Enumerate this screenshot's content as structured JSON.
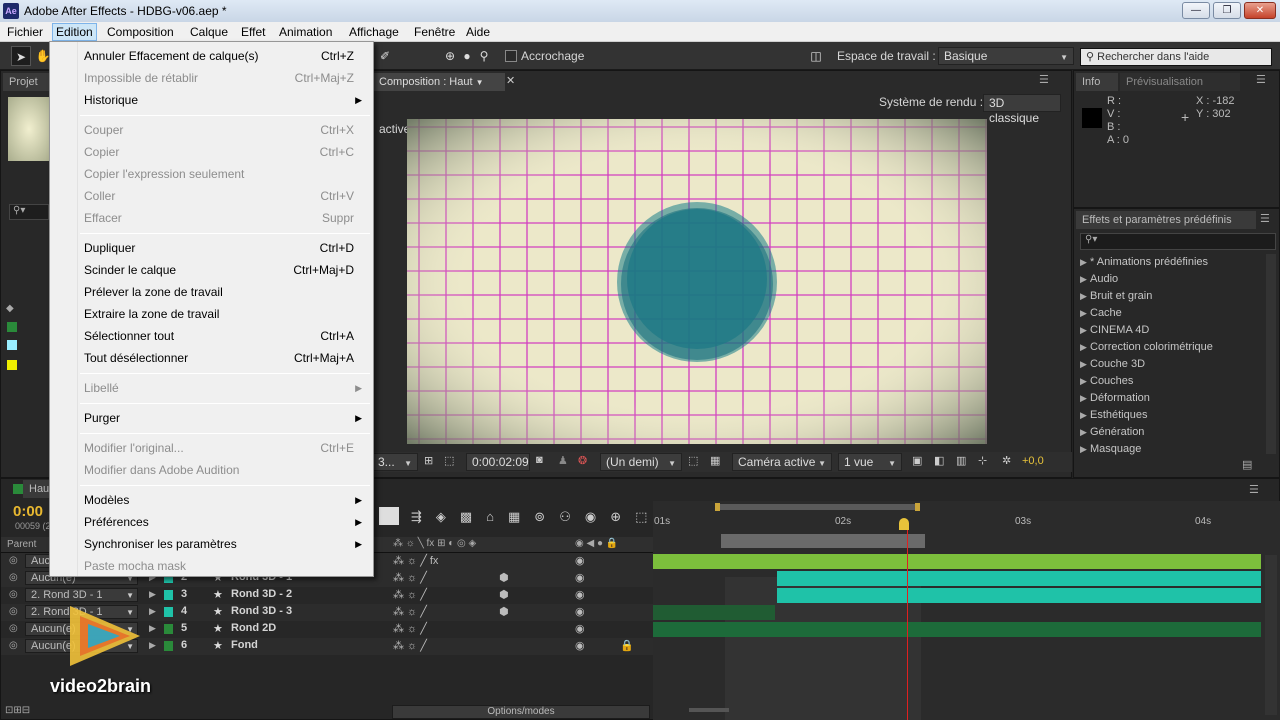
{
  "window": {
    "app_icon": "Ae",
    "title": "Adobe After Effects - HDBG-v06.aep *",
    "minimize": "—",
    "maximize": "❐",
    "close": "✕"
  },
  "menubar": {
    "items": [
      "Fichier",
      "Edition",
      "Composition",
      "Calque",
      "Effet",
      "Animation",
      "Affichage",
      "Fenêtre",
      "Aide"
    ],
    "active": "Edition"
  },
  "toolbar": {
    "snapping_label": "Accrochage",
    "workspace_label": "Espace de travail :",
    "workspace_value": "Basique",
    "help_search_placeholder": "Rechercher dans l'aide"
  },
  "project_panel": {
    "tab": "Projet"
  },
  "composition_panel": {
    "tab": "Composition : Haut",
    "render_label": "Système de rendu :",
    "render_value": "3D classique",
    "active_label": "active",
    "zoom_value": "3...",
    "timecode": "0:00:02:09",
    "resolution_value": "(Un demi)",
    "camera_value": "Caméra active",
    "views_value": "1 vue",
    "exposure_value": "+0,0"
  },
  "info_panel": {
    "tab": "Info",
    "tab2": "Prévisualisation",
    "r": "R :",
    "v": "V :",
    "b": "B :",
    "a": "A : 0",
    "x": "X : -182",
    "y": "Y : 302"
  },
  "effects_panel": {
    "title": "Effets et paramètres prédéfinis",
    "items": [
      "* Animations prédéfinies",
      "Audio",
      "Bruit et grain",
      "Cache",
      "CINEMA 4D",
      "Correction colorimétrique",
      "Couche 3D",
      "Couches",
      "Déformation",
      "Esthétiques",
      "Génération",
      "Masquage"
    ]
  },
  "edit_menu": {
    "items": [
      {
        "label": "Annuler Effacement de calque(s)",
        "shortcut": "Ctrl+Z",
        "enabled": true
      },
      {
        "label": "Impossible de rétablir",
        "shortcut": "Ctrl+Maj+Z",
        "enabled": false
      },
      {
        "label": "Historique",
        "shortcut": "",
        "enabled": true,
        "submenu": true
      },
      {
        "label": "Couper",
        "shortcut": "Ctrl+X",
        "enabled": false
      },
      {
        "label": "Copier",
        "shortcut": "Ctrl+C",
        "enabled": false
      },
      {
        "label": "Copier l'expression seulement",
        "shortcut": "",
        "enabled": false
      },
      {
        "label": "Coller",
        "shortcut": "Ctrl+V",
        "enabled": false
      },
      {
        "label": "Effacer",
        "shortcut": "Suppr",
        "enabled": false
      },
      {
        "label": "Dupliquer",
        "shortcut": "Ctrl+D",
        "enabled": true
      },
      {
        "label": "Scinder le calque",
        "shortcut": "Ctrl+Maj+D",
        "enabled": true
      },
      {
        "label": "Prélever la zone de travail",
        "shortcut": "",
        "enabled": true
      },
      {
        "label": "Extraire la zone de travail",
        "shortcut": "",
        "enabled": true
      },
      {
        "label": "Sélectionner tout",
        "shortcut": "Ctrl+A",
        "enabled": true
      },
      {
        "label": "Tout désélectionner",
        "shortcut": "Ctrl+Maj+A",
        "enabled": true
      },
      {
        "label": "Libellé",
        "shortcut": "",
        "enabled": false,
        "submenu": true
      },
      {
        "label": "Purger",
        "shortcut": "",
        "enabled": true,
        "submenu": true
      },
      {
        "label": "Modifier l'original...",
        "shortcut": "Ctrl+E",
        "enabled": false
      },
      {
        "label": "Modifier dans Adobe Audition",
        "shortcut": "",
        "enabled": false
      },
      {
        "label": "Modèles",
        "shortcut": "",
        "enabled": true,
        "submenu": true
      },
      {
        "label": "Préférences",
        "shortcut": "",
        "enabled": true,
        "submenu": true
      },
      {
        "label": "Synchroniser les paramètres",
        "shortcut": "",
        "enabled": true,
        "submenu": true
      },
      {
        "label": "Paste mocha mask",
        "shortcut": "",
        "enabled": false
      }
    ]
  },
  "timeline": {
    "tab": "Haut",
    "timecode": "0:00",
    "frame": "00059 (2",
    "parent_header": "Parent",
    "ruler": [
      "01s",
      "02s",
      "03s",
      "04s"
    ],
    "layers": [
      {
        "num": "2",
        "name": "Rond 3D - 1",
        "parent": "Aucun(e)"
      },
      {
        "num": "3",
        "name": "Rond 3D - 2",
        "parent": "2. Rond 3D - 1"
      },
      {
        "num": "4",
        "name": "Rond 3D - 3",
        "parent": "2. Rond 3D - 1"
      },
      {
        "num": "5",
        "name": "Rond 2D",
        "parent": "Aucun(e)"
      },
      {
        "num": "6",
        "name": "Fond",
        "parent": "Aucun(e)"
      }
    ],
    "parent_first": "Aucun(e)",
    "options": "Options/modes"
  },
  "watermark": {
    "brand": "video2brain"
  },
  "colors": {
    "accent_teal": "#1fc2a8",
    "accent_green": "#7cbf3c",
    "grid_magenta": "#d23fc0",
    "menu_bg": "#f0f0f0"
  }
}
